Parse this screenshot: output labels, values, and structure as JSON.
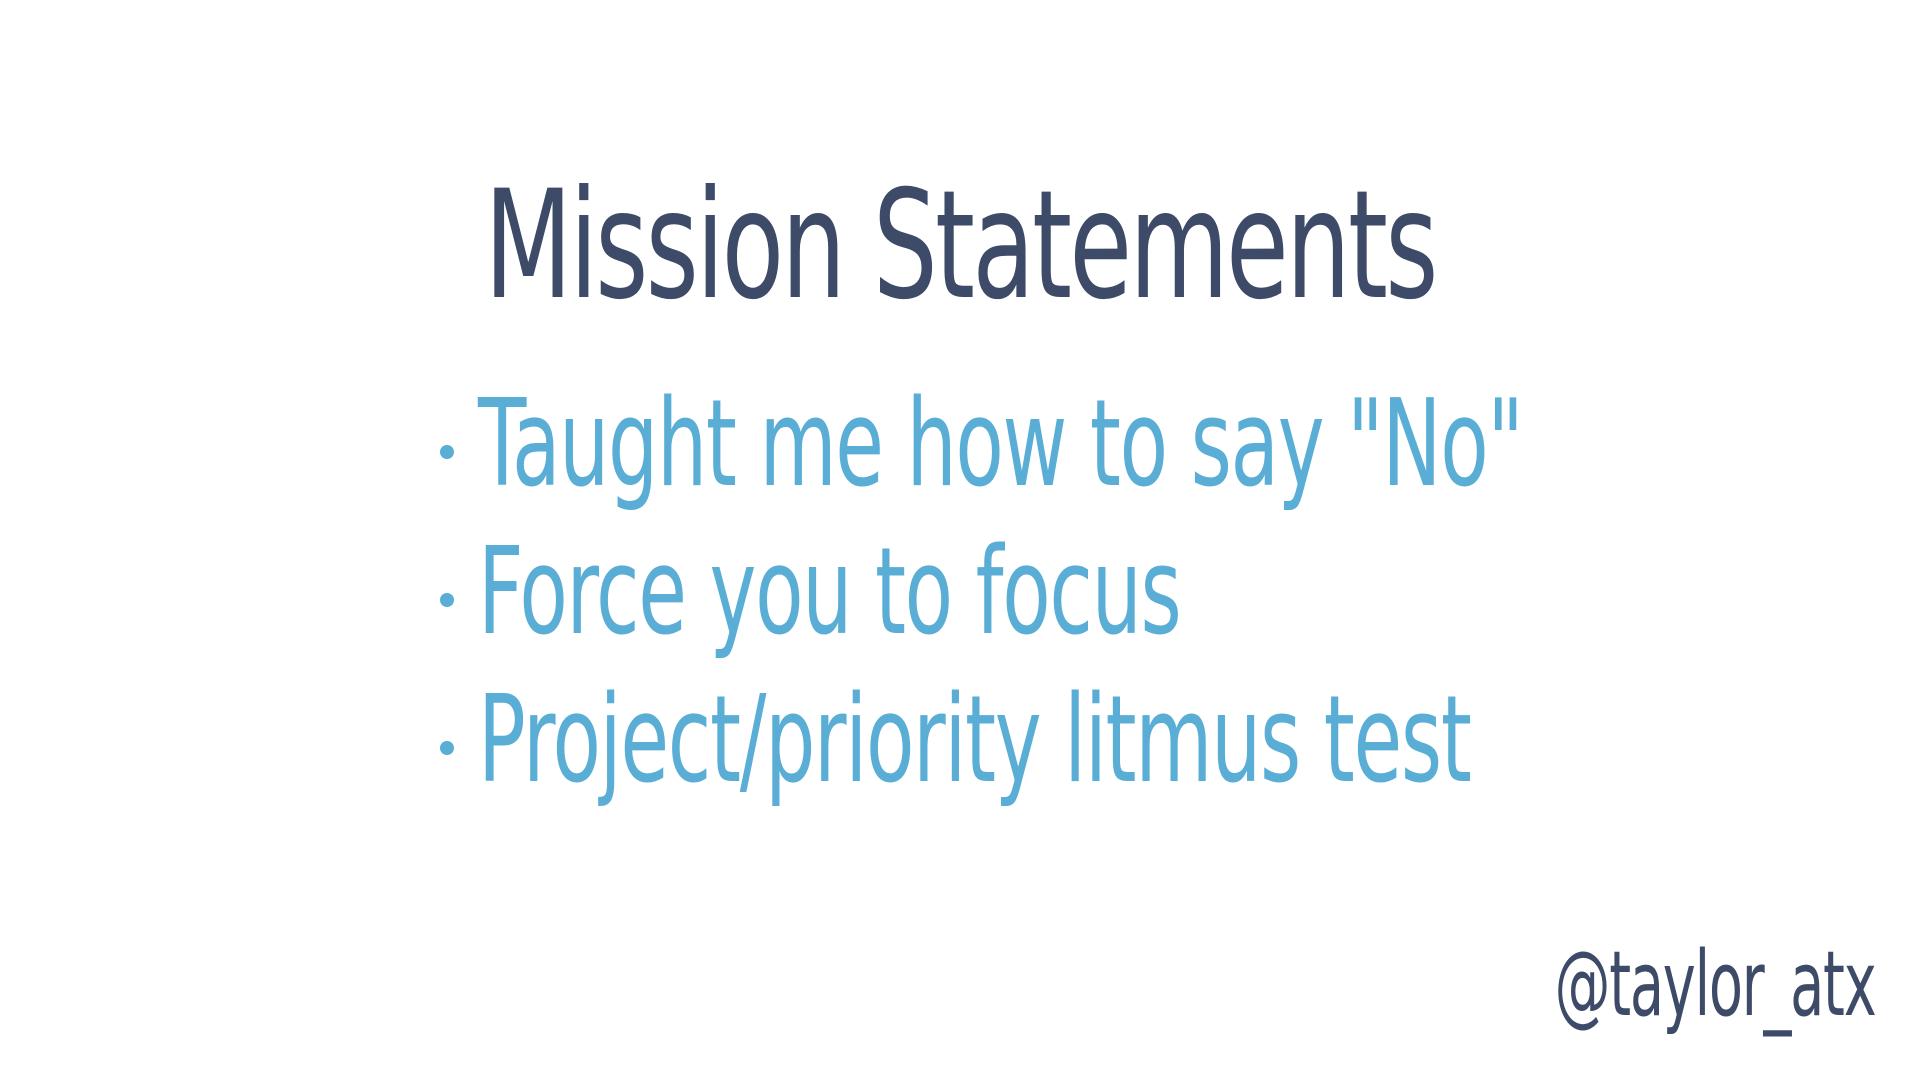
{
  "slide": {
    "title": "Mission Statements",
    "bullets": [
      {
        "text": "Taught me how to say \"No\""
      },
      {
        "text": "Force you to focus"
      },
      {
        "text": "Project/priority litmus test"
      }
    ],
    "handle": "@taylor_atx"
  },
  "colors": {
    "background": "#ffffff",
    "title": "#3d4a68",
    "bullets": "#5aaed6",
    "handle": "#3d4a68"
  }
}
